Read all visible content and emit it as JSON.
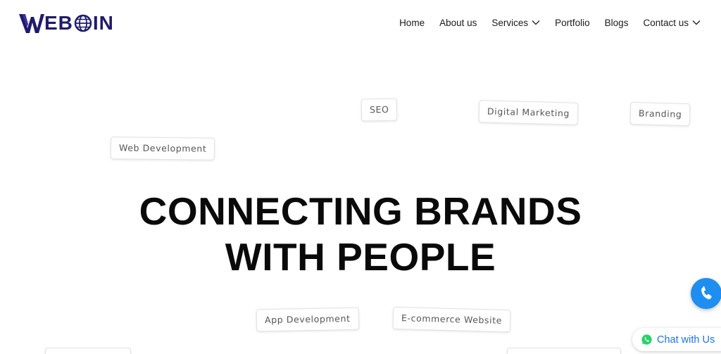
{
  "header": {
    "logo_text_before": "W",
    "logo_text_mid": "EB",
    "logo_text_after": "IN",
    "logo_alt": "WEBOIN",
    "nav": [
      {
        "label": "Home",
        "has_dropdown": false
      },
      {
        "label": "About us",
        "has_dropdown": false
      },
      {
        "label": "Services",
        "has_dropdown": true
      },
      {
        "label": "Portfolio",
        "has_dropdown": false
      },
      {
        "label": "Blogs",
        "has_dropdown": false
      },
      {
        "label": "Contact us",
        "has_dropdown": true
      }
    ]
  },
  "tags": {
    "seo": "SEO",
    "digital_marketing": "Digital Marketing",
    "branding": "Branding",
    "web_development": "Web Development",
    "app_development": "App Development",
    "ecommerce": "E-commerce Website"
  },
  "hero": {
    "line1": "CONNECTING BRANDS",
    "line2": "WITH PEOPLE"
  },
  "floating": {
    "phone_icon": "phone-icon",
    "chat_label": "Chat with Us",
    "chat_icon": "whatsapp-icon"
  },
  "colors": {
    "logo": "#1f1b6b",
    "phone_button": "#1e8ef0",
    "chat_text": "#1a73e8",
    "whatsapp": "#25d366"
  }
}
